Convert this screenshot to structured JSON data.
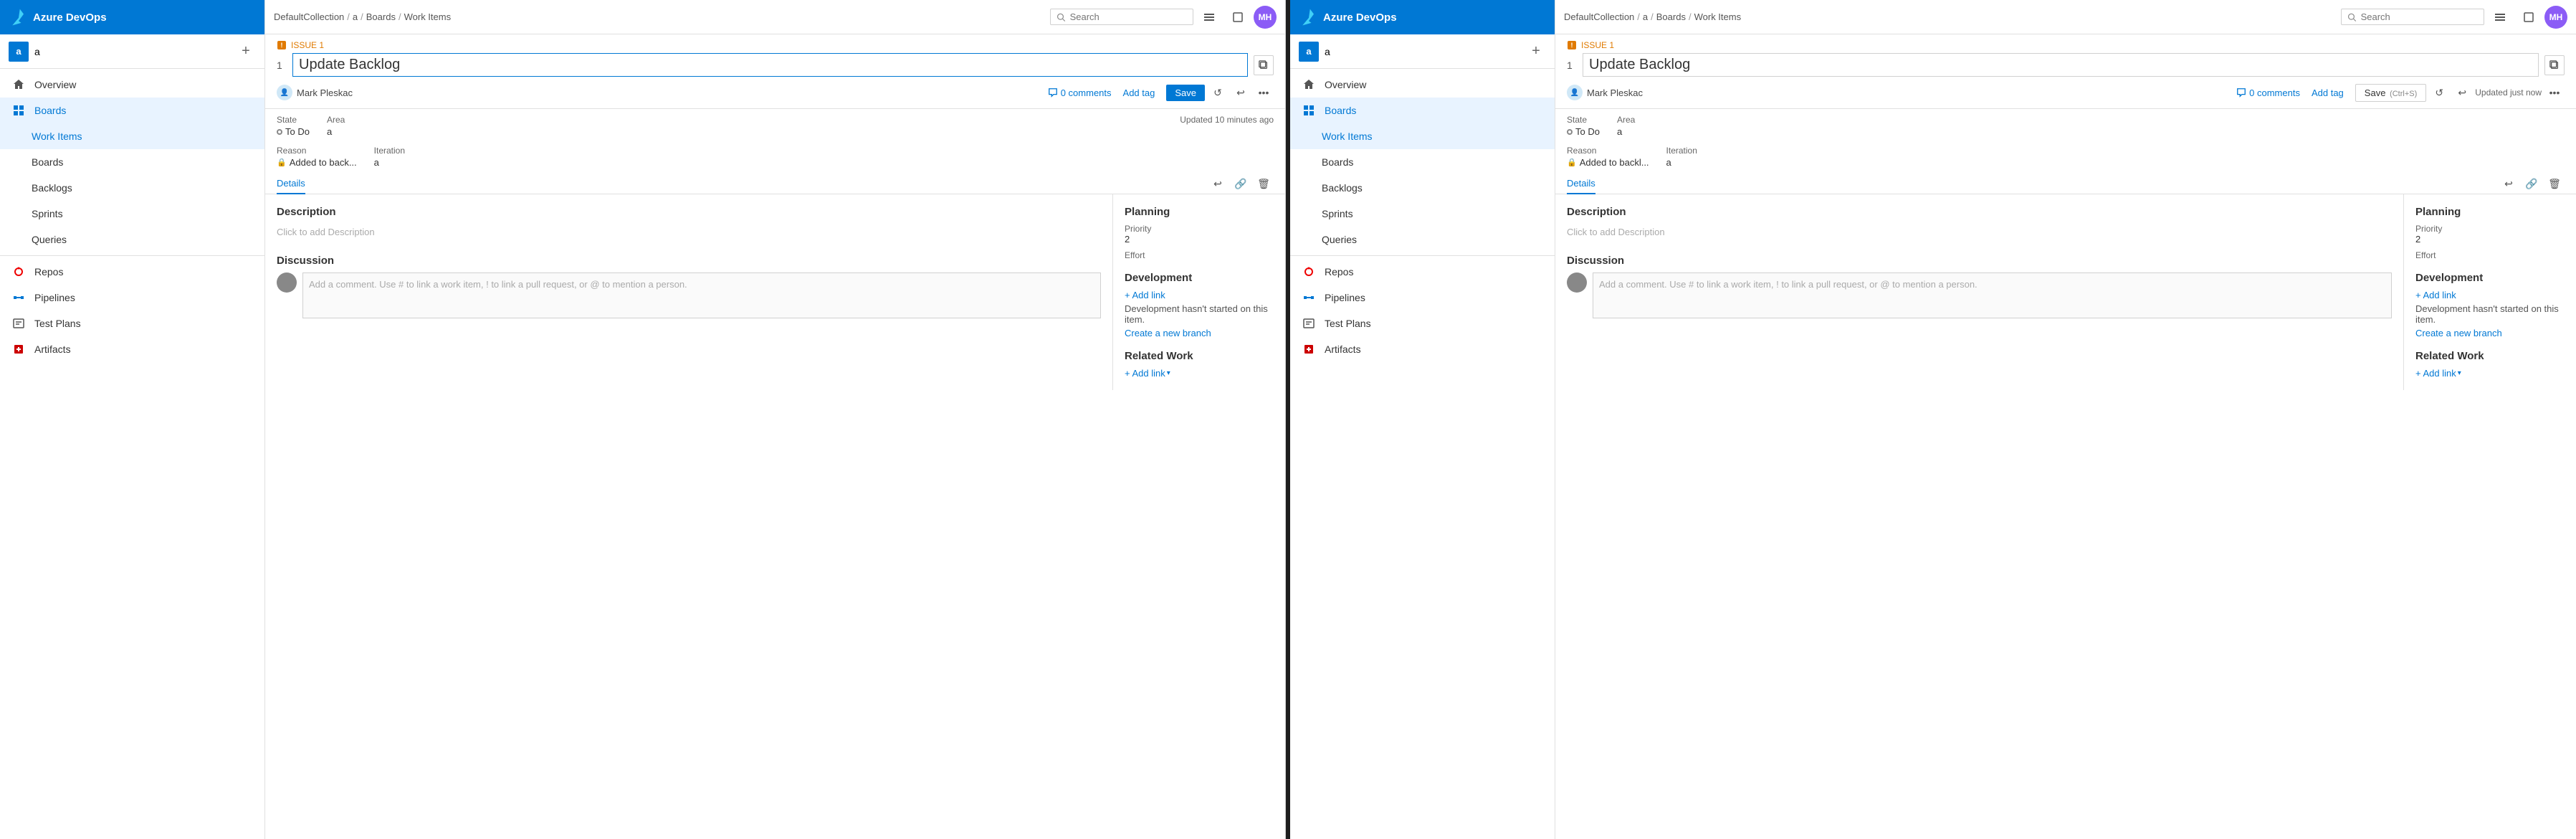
{
  "panel1": {
    "topbar": {
      "breadcrumb": [
        "DefaultCollection",
        "a",
        "Boards",
        "Work Items"
      ],
      "search_placeholder": "Search"
    },
    "sidebar": {
      "logo": "Azure DevOps",
      "org": "a",
      "org_initial": "a",
      "nav_items": [
        {
          "id": "overview",
          "label": "Overview",
          "icon": "home"
        },
        {
          "id": "boards",
          "label": "Boards",
          "icon": "boards",
          "active": true
        },
        {
          "id": "work-items",
          "label": "Work Items",
          "icon": "work-items",
          "active": true,
          "sub": false
        },
        {
          "id": "boards-sub",
          "label": "Boards",
          "icon": "boards-sub",
          "sub": true
        },
        {
          "id": "backlogs",
          "label": "Backlogs",
          "icon": "backlogs",
          "sub": true
        },
        {
          "id": "sprints",
          "label": "Sprints",
          "icon": "sprints",
          "sub": true
        },
        {
          "id": "queries",
          "label": "Queries",
          "icon": "queries",
          "sub": true
        },
        {
          "id": "repos",
          "label": "Repos",
          "icon": "repos"
        },
        {
          "id": "pipelines",
          "label": "Pipelines",
          "icon": "pipelines"
        },
        {
          "id": "test-plans",
          "label": "Test Plans",
          "icon": "test-plans"
        },
        {
          "id": "artifacts",
          "label": "Artifacts",
          "icon": "artifacts"
        }
      ]
    },
    "issue": {
      "type_label": "ISSUE 1",
      "number": "1",
      "title": "Update Backlog",
      "author": "Mark Pleskac",
      "comments": "0 comments",
      "add_tag": "Add tag",
      "save_label": "Save",
      "state_label": "State",
      "state_value": "To Do",
      "area_label": "Area",
      "area_value": "a",
      "reason_label": "Reason",
      "reason_value": "Added to back...",
      "iteration_label": "Iteration",
      "iteration_value": "a",
      "updated_text": "Updated 10 minutes ago",
      "details_tab": "Details",
      "description_title": "Description",
      "description_placeholder": "Click to add Description",
      "discussion_title": "Discussion",
      "comment_placeholder": "Add a comment. Use # to link a work item, ! to link a pull request, or @ to mention a person.",
      "planning_title": "Planning",
      "priority_label": "Priority",
      "priority_value": "2",
      "effort_label": "Effort",
      "development_title": "Development",
      "add_link_label": "+ Add link",
      "dev_empty_text": "Development hasn't started on this item.",
      "create_branch_label": "Create a new branch",
      "related_work_title": "Related Work",
      "add_link_dropdown": "+ Add link"
    },
    "user_initials": "MH"
  },
  "panel2": {
    "topbar": {
      "breadcrumb": [
        "DefaultCollection",
        "a",
        "Boards",
        "Work Items"
      ],
      "search_placeholder": "Search"
    },
    "sidebar": {
      "logo": "Azure DevOps",
      "org": "a",
      "org_initial": "a",
      "nav_items": [
        {
          "id": "overview",
          "label": "Overview",
          "icon": "home"
        },
        {
          "id": "boards",
          "label": "Boards",
          "icon": "boards",
          "active": true
        },
        {
          "id": "work-items",
          "label": "Work Items",
          "icon": "work-items"
        },
        {
          "id": "boards-sub",
          "label": "Boards",
          "icon": "boards-sub",
          "sub": true
        },
        {
          "id": "backlogs",
          "label": "Backlogs",
          "icon": "backlogs",
          "sub": true
        },
        {
          "id": "sprints",
          "label": "Sprints",
          "icon": "sprints",
          "sub": true
        },
        {
          "id": "queries",
          "label": "Queries",
          "icon": "queries",
          "sub": true
        },
        {
          "id": "repos",
          "label": "Repos",
          "icon": "repos"
        },
        {
          "id": "pipelines",
          "label": "Pipelines",
          "icon": "pipelines"
        },
        {
          "id": "test-plans",
          "label": "Test Plans",
          "icon": "test-plans"
        },
        {
          "id": "artifacts",
          "label": "Artifacts",
          "icon": "artifacts"
        }
      ]
    },
    "issue": {
      "type_label": "ISSUE 1",
      "number": "1",
      "title": "Update Backlog",
      "author": "Mark Pleskac",
      "comments": "0 comments",
      "add_tag": "Add tag",
      "save_label": "Save",
      "save_shortcut": "(Ctrl+S)",
      "updated_text": "Updated just now",
      "state_label": "State",
      "state_value": "To Do",
      "area_label": "Area",
      "area_value": "a",
      "reason_label": "Reason",
      "reason_value": "Added to backl...",
      "iteration_label": "Iteration",
      "iteration_value": "a",
      "details_tab": "Details",
      "description_title": "Description",
      "description_placeholder": "Click to add Description",
      "discussion_title": "Discussion",
      "comment_placeholder": "Add a comment. Use # to link a work item, ! to link a pull request, or @ to mention a person.",
      "planning_title": "Planning",
      "priority_label": "Priority",
      "priority_value": "2",
      "effort_label": "Effort",
      "development_title": "Development",
      "add_link_label": "+ Add link",
      "dev_empty_text": "Development hasn't started on this item.",
      "create_branch_label": "Create a new branch",
      "related_work_title": "Related Work",
      "add_link_dropdown": "+ Add link"
    },
    "user_initials": "MH"
  }
}
